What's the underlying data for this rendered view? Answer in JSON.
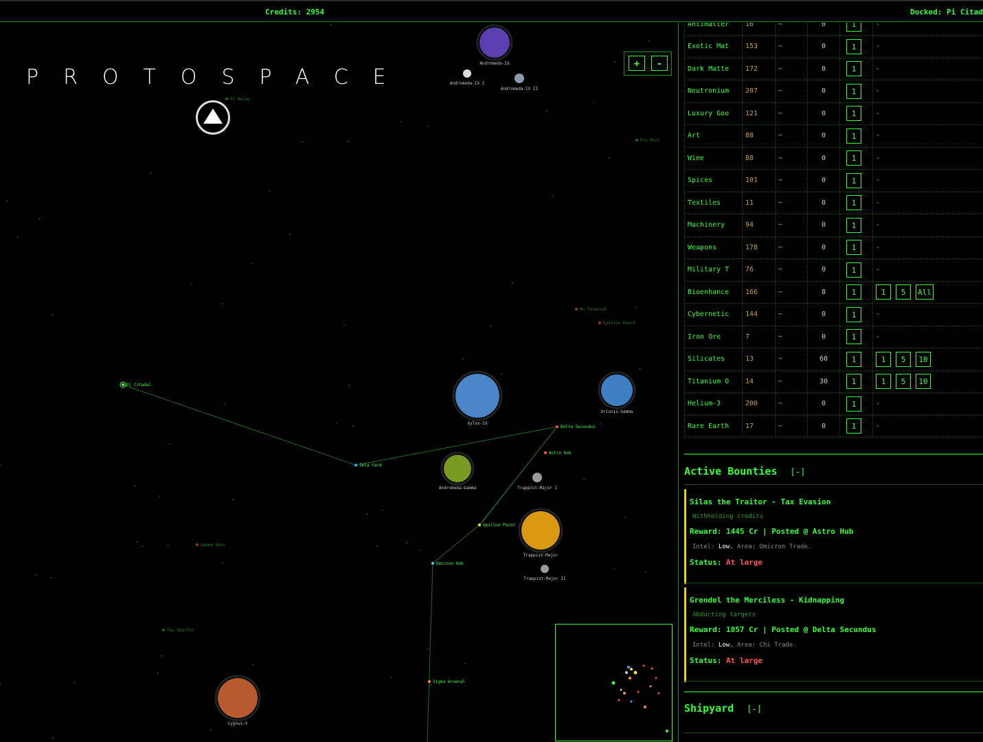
{
  "topbar": {
    "credits": "Credits: 2954",
    "docked": "Docked: Pi Citad"
  },
  "logo": "PROTOSPACE",
  "zoom": {
    "plus": "+",
    "minus": "-"
  },
  "map": {
    "planets": [
      {
        "name": "Andromeda-IX",
        "color": "#5a3fb0"
      },
      {
        "name": "Andromeda-IX I",
        "color": "#dddddd"
      },
      {
        "name": "Andromeda-IX II",
        "color": "#8a9ab0"
      },
      {
        "name": "Xylos-IX",
        "color": "#4a86c8"
      },
      {
        "name": "Orionis-Gamma",
        "color": "#3e7fc4"
      },
      {
        "name": "Andromeda-Gamma",
        "color": "#7a9a22"
      },
      {
        "name": "Trappist-Major I",
        "color": "#9a9a9a"
      },
      {
        "name": "Trappist-Major",
        "color": "#d99a12"
      },
      {
        "name": "Trappist-Major II",
        "color": "#9a9a9a"
      },
      {
        "name": "Cygnus-V",
        "color": "#b85a30"
      }
    ],
    "stations": [
      {
        "name": "Pi Citadel",
        "color": "#33ff33",
        "dim": false
      },
      {
        "name": "Zeta Yard",
        "color": "#4aa0ff",
        "dim": false
      },
      {
        "name": "Delta Secundus",
        "color": "#ff5533",
        "dim": false
      },
      {
        "name": "Astro Hub",
        "color": "#ff5533",
        "dim": false
      },
      {
        "name": "Upsilon Point",
        "color": "#ffdd22",
        "dim": false
      },
      {
        "name": "Omicron Hub",
        "color": "#33ccff",
        "dim": false
      },
      {
        "name": "Sigma Arsenal",
        "color": "#ff8833",
        "dim": false
      },
      {
        "name": "Mu Terminal",
        "color": "#ff5533",
        "dim": true
      },
      {
        "name": "Epsilon Reach",
        "color": "#ff5533",
        "dim": true
      },
      {
        "name": "Gamma Vein",
        "color": "#ff5533",
        "dim": true
      },
      {
        "name": "Tau Quarter",
        "color": "#33aa33",
        "dim": true
      },
      {
        "name": "Psi Port",
        "color": "#33aa33",
        "dim": true
      },
      {
        "name": "Pi Relay",
        "color": "#33aa33",
        "dim": true
      }
    ]
  },
  "market": {
    "rows": [
      {
        "name": "Antimatter",
        "price": "16",
        "trend": "~",
        "held": "0",
        "buy": [
          "1"
        ],
        "sell": [],
        "sell_placeholder": "-"
      },
      {
        "name": "Exotic Mat",
        "price": "153",
        "trend": "~",
        "held": "0",
        "buy": [
          "1"
        ],
        "sell": [],
        "sell_placeholder": "-"
      },
      {
        "name": "Dark Matte",
        "price": "172",
        "trend": "~",
        "held": "0",
        "buy": [
          "1"
        ],
        "sell": [],
        "sell_placeholder": "-"
      },
      {
        "name": "Neutronium",
        "price": "207",
        "trend": "~",
        "held": "0",
        "buy": [
          "1"
        ],
        "sell": [],
        "sell_placeholder": "-"
      },
      {
        "name": "Luxury Goo",
        "price": "121",
        "trend": "~",
        "held": "0",
        "buy": [
          "1"
        ],
        "sell": [],
        "sell_placeholder": "-"
      },
      {
        "name": "Art",
        "price": "88",
        "trend": "~",
        "held": "0",
        "buy": [
          "1"
        ],
        "sell": [],
        "sell_placeholder": "-"
      },
      {
        "name": "Wine",
        "price": "88",
        "trend": "~",
        "held": "0",
        "buy": [
          "1"
        ],
        "sell": [],
        "sell_placeholder": "-"
      },
      {
        "name": "Spices",
        "price": "101",
        "trend": "~",
        "held": "0",
        "buy": [
          "1"
        ],
        "sell": [],
        "sell_placeholder": "-"
      },
      {
        "name": "Textiles",
        "price": "11",
        "trend": "~",
        "held": "0",
        "buy": [
          "1"
        ],
        "sell": [],
        "sell_placeholder": "-"
      },
      {
        "name": "Machinery",
        "price": "94",
        "trend": "~",
        "held": "0",
        "buy": [
          "1"
        ],
        "sell": [],
        "sell_placeholder": "-"
      },
      {
        "name": "Weapons",
        "price": "178",
        "trend": "~",
        "held": "0",
        "buy": [
          "1"
        ],
        "sell": [],
        "sell_placeholder": "-"
      },
      {
        "name": "Military T",
        "price": "76",
        "trend": "~",
        "held": "0",
        "buy": [
          "1"
        ],
        "sell": [],
        "sell_placeholder": "-"
      },
      {
        "name": "Bioenhance",
        "price": "166",
        "trend": "~",
        "held": "8",
        "buy": [
          "1"
        ],
        "sell": [
          "1",
          "5",
          "All"
        ],
        "sell_placeholder": ""
      },
      {
        "name": "Cybernetic",
        "price": "144",
        "trend": "~",
        "held": "0",
        "buy": [
          "1"
        ],
        "sell": [],
        "sell_placeholder": "-"
      },
      {
        "name": "Iron Ore",
        "price": "7",
        "trend": "~",
        "held": "0",
        "buy": [
          "1"
        ],
        "sell": [],
        "sell_placeholder": "-"
      },
      {
        "name": "Silicates",
        "price": "13",
        "trend": "~",
        "held": "60",
        "buy": [
          "1"
        ],
        "sell": [
          "1",
          "5",
          "10"
        ],
        "sell_placeholder": ""
      },
      {
        "name": "Titanium O",
        "price": "14",
        "trend": "~",
        "held": "30",
        "buy": [
          "1"
        ],
        "sell": [
          "1",
          "5",
          "10"
        ],
        "sell_placeholder": ""
      },
      {
        "name": "Helium-3",
        "price": "200",
        "trend": "~",
        "held": "0",
        "buy": [
          "1"
        ],
        "sell": [],
        "sell_placeholder": "-"
      },
      {
        "name": "Rare Earth",
        "price": "17",
        "trend": "~",
        "held": "0",
        "buy": [
          "1"
        ],
        "sell": [],
        "sell_placeholder": "-"
      }
    ]
  },
  "bounties": {
    "title": "Active Bounties",
    "toggle": "[-]",
    "items": [
      {
        "title": "Silas the Traitor - Tax Evasion",
        "desc": "Withholding credits",
        "reward": "Reward: 1445 Cr | Posted @ Astro Hub",
        "intel_label": "Intel:",
        "intel_level": "Low.",
        "intel_area": "Area: Omicron Trade.",
        "status_label": "Status:",
        "status_value": "At large"
      },
      {
        "title": "Grendel the Merciless - Kidnapping",
        "desc": "Abducting targets",
        "reward": "Reward: 1857 Cr | Posted @ Delta Secundus",
        "intel_label": "Intel:",
        "intel_level": "Low.",
        "intel_area": "Area: Chi Trade.",
        "status_label": "Status:",
        "status_value": "At large"
      }
    ]
  },
  "shipyard": {
    "title": "Shipyard",
    "toggle": "[-]"
  }
}
